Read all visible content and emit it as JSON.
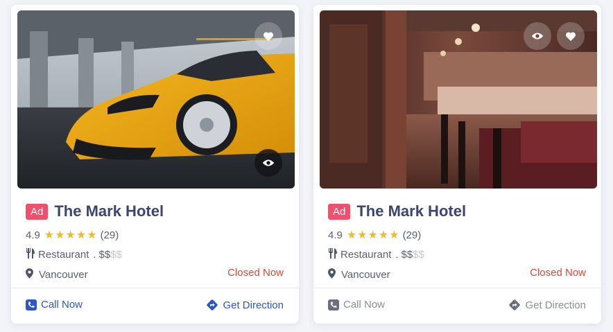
{
  "cards": [
    {
      "image_alt": "yellow sports car under a bridge",
      "ad_label": "Ad",
      "title": "The Mark Hotel",
      "rating": "4.9",
      "stars": "★★★★★",
      "reviews": "(29)",
      "category": "Restaurant",
      "price_sep": ".",
      "price_active": "$$",
      "price_muted": "$$",
      "location": "Vancouver",
      "status": "Closed Now",
      "call_label": "Call Now",
      "direction_label": "Get Direction",
      "action_color": "#2f56c8"
    },
    {
      "image_alt": "restaurant interior with bar and tables",
      "ad_label": "Ad",
      "title": "The Mark Hotel",
      "rating": "4.9",
      "stars": "★★★★★",
      "reviews": "(29)",
      "category": "Restaurant",
      "price_sep": ".",
      "price_active": "$$",
      "price_muted": "$$",
      "location": "Vancouver",
      "status": "Closed Now",
      "call_label": "Call Now",
      "direction_label": "Get Direction",
      "action_color": "#8a8e99"
    }
  ],
  "colors": {
    "ad_badge": "#f0506e",
    "title": "#3b4570",
    "stars": "#f2b92a",
    "closed": "#d24a3b"
  }
}
